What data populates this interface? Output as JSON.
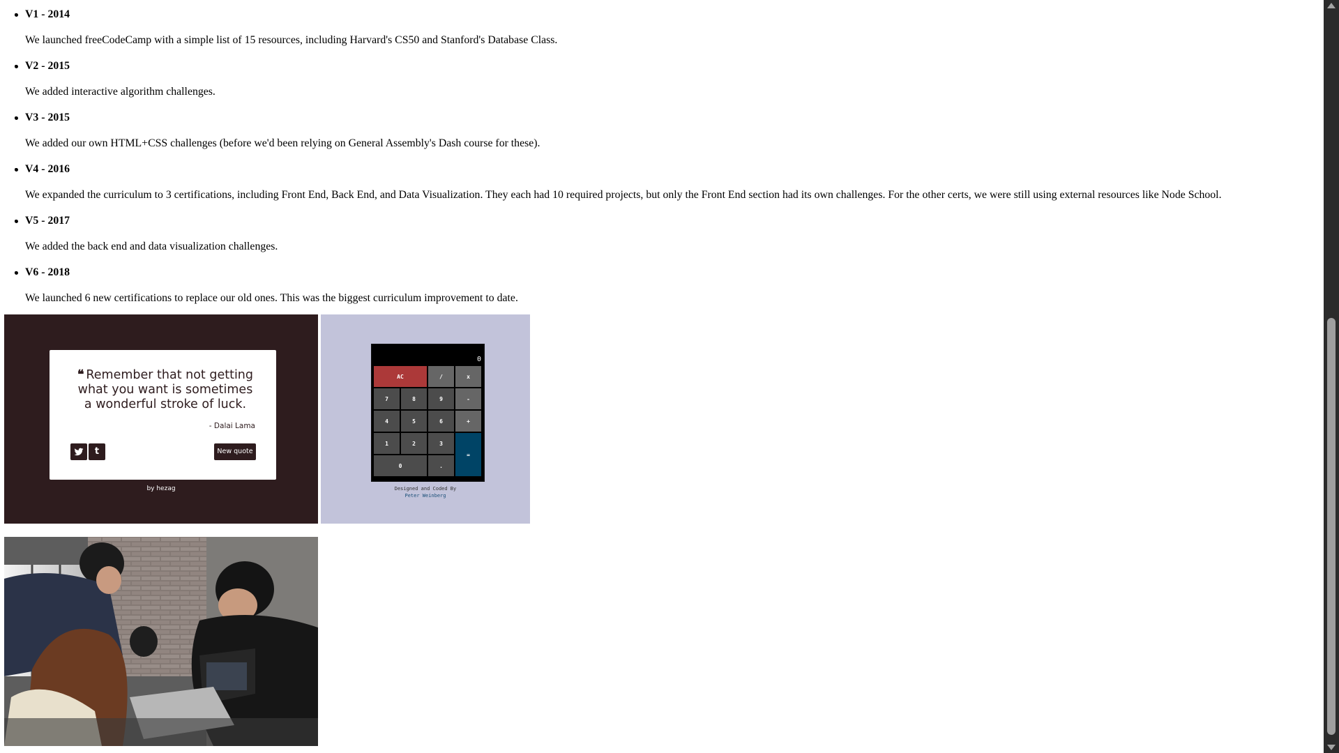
{
  "timeline": [
    {
      "title": "V1 - 2014",
      "desc": "We launched freeCodeCamp with a simple list of 15 resources, including Harvard's CS50 and Stanford's Database Class."
    },
    {
      "title": "V2 - 2015",
      "desc": "We added interactive algorithm challenges."
    },
    {
      "title": "V3 - 2015",
      "desc": "We added our own HTML+CSS challenges (before we'd been relying on General Assembly's Dash course for these)."
    },
    {
      "title": "V4 - 2016",
      "desc": "We expanded the curriculum to 3 certifications, including Front End, Back End, and Data Visualization. They each had 10 required projects, but only the Front End section had its own challenges. For the other certs, we were still using external resources like Node School."
    },
    {
      "title": "V5 - 2017",
      "desc": "We added the back end and data visualization challenges."
    },
    {
      "title": "V6 - 2018",
      "desc": "We launched 6 new certifications to replace our old ones. This was the biggest curriculum improvement to date."
    }
  ],
  "quote_project": {
    "quote_mark": "❝",
    "quote": "Remember that not getting what you want is sometimes a wonderful stroke of luck.",
    "author": "- Dalai Lama",
    "twitter_glyph": "t",
    "tumblr_glyph": "t",
    "new_quote_label": "New quote",
    "byline": "by hezag",
    "bg_color": "#2e1c1e"
  },
  "calc_project": {
    "display": "0",
    "keys": {
      "ac": "AC",
      "divide": "/",
      "multiply": "x",
      "k7": "7",
      "k8": "8",
      "k9": "9",
      "minus": "-",
      "k4": "4",
      "k5": "5",
      "k6": "6",
      "plus": "+",
      "k1": "1",
      "k2": "2",
      "k3": "3",
      "equals": "=",
      "k0": "0",
      "decimal": "."
    },
    "credit_line": "Designed and Coded By",
    "credit_author": "Peter Weinberg",
    "bg_color": "#c2c3da",
    "ac_color": "#ac3939",
    "equals_color": "#004466"
  },
  "photo_project": {
    "subject": "group of people looking at laptop"
  }
}
